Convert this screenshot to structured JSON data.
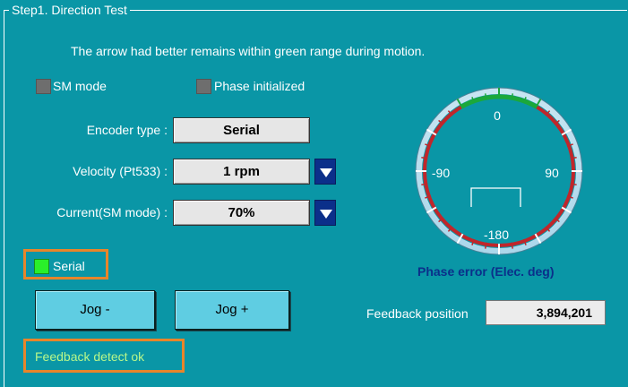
{
  "group": {
    "title": "Step1. Direction Test"
  },
  "instruction": "The arrow had better remains within green range during motion.",
  "checks": {
    "sm_mode": {
      "label": "SM mode",
      "checked": false
    },
    "phase_initialized": {
      "label": "Phase initialized",
      "checked": false
    }
  },
  "fields": {
    "encoder_type": {
      "label": "Encoder type :",
      "value": "Serial"
    },
    "velocity": {
      "label": "Velocity (Pt533) :",
      "value": "1 rpm"
    },
    "current": {
      "label": "Current(SM mode) :",
      "value": "70%"
    }
  },
  "gauge": {
    "labels": {
      "top": "0",
      "left": "-90",
      "right": "90",
      "bottom": "-180"
    },
    "caption": "Phase error (Elec. deg)",
    "colors": {
      "green_range": "#1ba83b",
      "red_range": "#c0262b",
      "bezel": "#bfe2f2"
    }
  },
  "serial_indicator": {
    "label": "Serial",
    "on": true
  },
  "buttons": {
    "jog_minus": "Jog -",
    "jog_plus": "Jog +"
  },
  "feedback": {
    "label": "Feedback position",
    "value": "3,894,201"
  },
  "status": "Feedback detect ok",
  "colors": {
    "background": "#0a96a6",
    "highlight": "#e8852a",
    "button": "#5fcde2",
    "dropdown": "#0b2f8a"
  }
}
